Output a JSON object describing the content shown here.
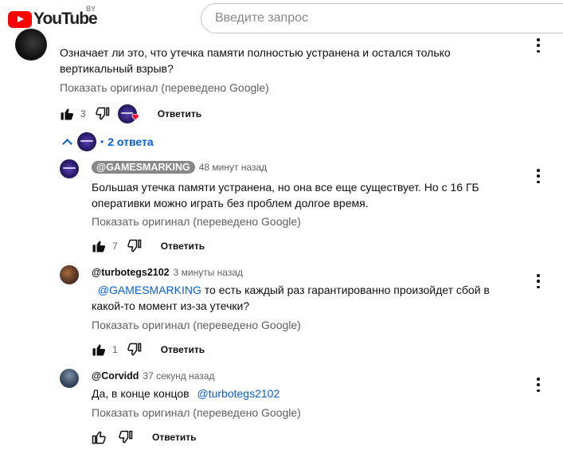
{
  "header": {
    "logo_text": "YouTube",
    "region": "BY",
    "search_placeholder": "Введите запрос"
  },
  "comment": {
    "text": "Означает ли это, что утечка памяти полностью устранена и остался только вертикальный взрыв?",
    "translate_label": "Показать оригинал (переведено Google)",
    "likes": "3",
    "reply_label": "Ответить",
    "replies_toggle_label": "2 ответа",
    "dot": "•"
  },
  "replies": [
    {
      "author": "@GAMESMARKING",
      "time": "48 минут назад",
      "text": "Большая утечка памяти устранена, но она все еще существует. Но с 16 ГБ оперативки можно играть без проблем долгое время.",
      "translate_label": "Показать оригинал (переведено Google)",
      "likes": "7",
      "reply_label": "Ответить"
    },
    {
      "author": "@turbotegs2102",
      "time": "3 минуты назад",
      "mention": "@GAMESMARKING",
      "text": " то есть каждый раз гарантированно произойдет сбой в какой-то момент из-за утечки?",
      "translate_label": "Показать оригинал (переведено Google)",
      "likes": "1",
      "reply_label": "Ответить"
    },
    {
      "author": "@Corvidd",
      "time": "37 секунд назад",
      "text": "Да, в конце концов ",
      "mention": "@turbotegs2102",
      "translate_label": "Показать оригинал (переведено Google)",
      "reply_label": "Ответить"
    }
  ],
  "colors": {
    "link": "#065fd4",
    "youtube_red": "#ff0000",
    "muted": "#606060"
  }
}
